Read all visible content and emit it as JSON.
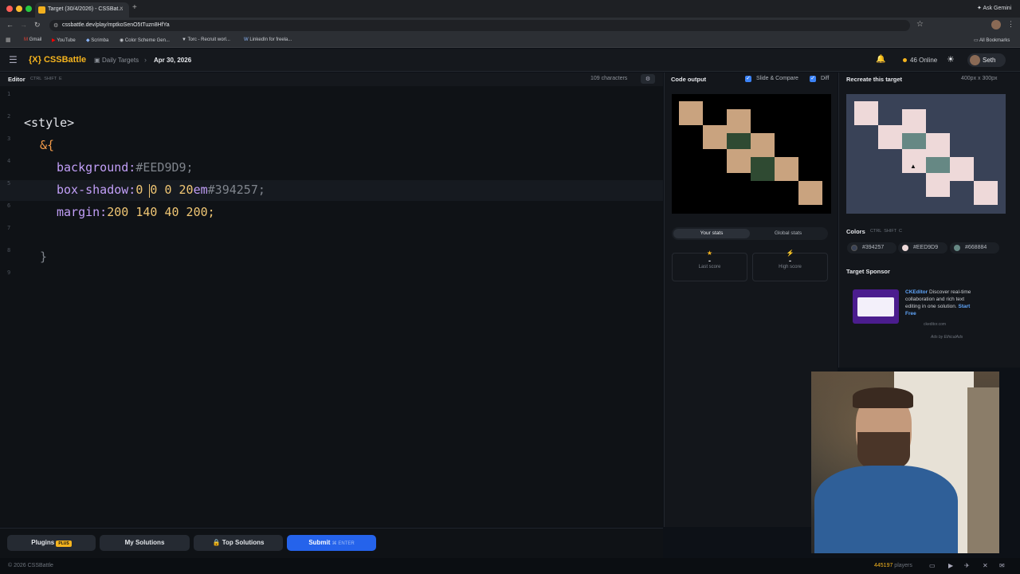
{
  "browser": {
    "tab_title": "Target (30/4/2026) - CSSBat...",
    "url": "cssbattle.dev/play/mptkoSenO5tTuzn8HfYa",
    "ask_gemini": "Ask Gemini",
    "bookmarks": [
      "Gmail",
      "YouTube",
      "Scrimba",
      "Color Scheme Gen...",
      "Torc - Recruit worl...",
      "LinkedIn for freela..."
    ],
    "all_bookmarks": "All Bookmarks"
  },
  "header": {
    "logo": "{X} CSSBattle",
    "crumb_parent": "Daily Targets",
    "crumb_current": "Apr 30, 2026",
    "online": "46 Online",
    "user": "Seth"
  },
  "editor": {
    "title": "Editor",
    "shortcut": "CTRL  SHIFT  E",
    "char_count": "109 characters",
    "line_numbers": [
      "1",
      "2",
      "3",
      "4",
      "5",
      "6",
      "7",
      "8",
      "9"
    ],
    "lines": {
      "l2": "<style>",
      "l3": "&{",
      "l4_prop": "background:",
      "l4_val": "#EED9D9;",
      "l5_prop": "box-shadow:",
      "l5_val": "0 0 0 20",
      "l5_unit": "em",
      "l5_color": "#394257;",
      "l6_prop": "margin:",
      "l6_val": "200 140 40 200;",
      "l8": "}"
    }
  },
  "bottom_bar": {
    "plugins": "Plugins",
    "plugins_badge": "PLUS",
    "my_solutions": "My Solutions",
    "top_solutions": "Top Solutions",
    "submit": "Submit",
    "submit_hint": "ENTER"
  },
  "output": {
    "title": "Code output",
    "slide_compare": "Slide & Compare",
    "diff": "Diff",
    "your_stats": "Your stats",
    "global_stats": "Global stats",
    "last_score_value": "-",
    "last_score_label": "Last score",
    "high_score_value": "-",
    "high_score_label": "High score"
  },
  "target": {
    "title": "Recreate this target",
    "size": "400px x 300px",
    "colors_title": "Colors",
    "colors_shortcut": "CTRL  SHIFT  C",
    "colors": [
      {
        "hex": "#394257",
        "swatch": "#394257"
      },
      {
        "hex": "#EED9D9",
        "swatch": "#EED9D9"
      },
      {
        "hex": "#668884",
        "swatch": "#668884"
      }
    ],
    "sponsor_title": "Target Sponsor",
    "sponsor_name": "CKEditor",
    "sponsor_text": " Discover real-time collaboration and rich text editing in one solution. ",
    "sponsor_cta": "Start Free",
    "sponsor_domain": "ckeditor.com",
    "ads_by": "Ads by EthicalAds"
  },
  "footer": {
    "copyright": "© 2026 CSSBattle",
    "players": "445197",
    "players_label": " players"
  },
  "palette": {
    "accent": "#f5b41e",
    "tan": "#c9a37f",
    "dark_green": "#2f4a32",
    "target_bg": "#394257",
    "target_light": "#EED9D9",
    "target_green": "#668884",
    "submit_blue": "#2563eb"
  }
}
